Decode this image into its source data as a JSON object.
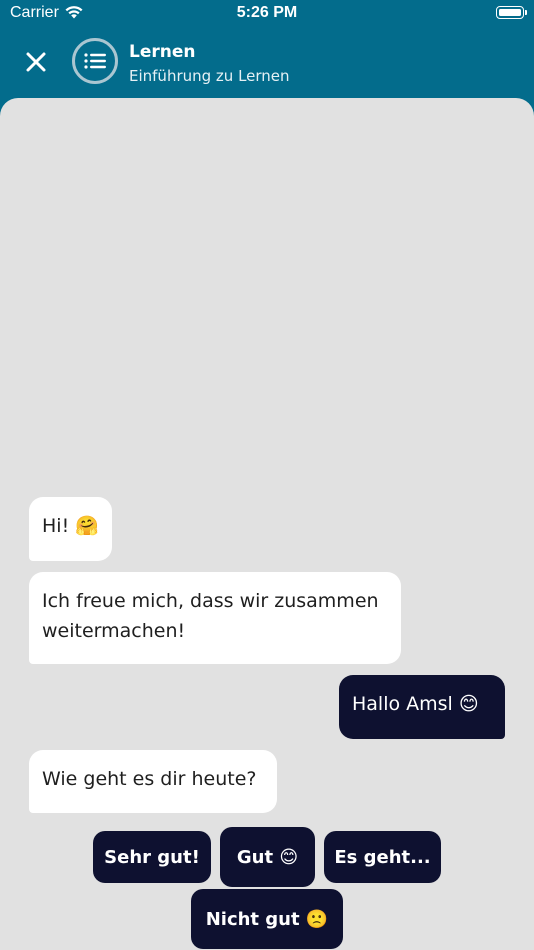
{
  "status_bar": {
    "carrier": "Carrier",
    "time": "5:26 PM"
  },
  "header": {
    "title": "Lernen",
    "subtitle": "Einführung zu Lernen"
  },
  "messages": [
    {
      "sender": "bot",
      "text": "Hi! 🤗"
    },
    {
      "sender": "bot",
      "text": "Ich freue mich, dass wir zusammen weitermachen!"
    },
    {
      "sender": "user",
      "text": "Hallo Amsl 😊"
    },
    {
      "sender": "bot",
      "text": "Wie geht es dir heute?"
    }
  ],
  "quick_replies": [
    "Sehr gut!",
    "Gut 😊",
    "Es geht...",
    "Nicht gut 🙁"
  ],
  "colors": {
    "header_bg": "#036c8c",
    "chat_bg": "#e1e1e1",
    "user_bubble": "#0e1130",
    "bot_bubble": "#ffffff"
  }
}
